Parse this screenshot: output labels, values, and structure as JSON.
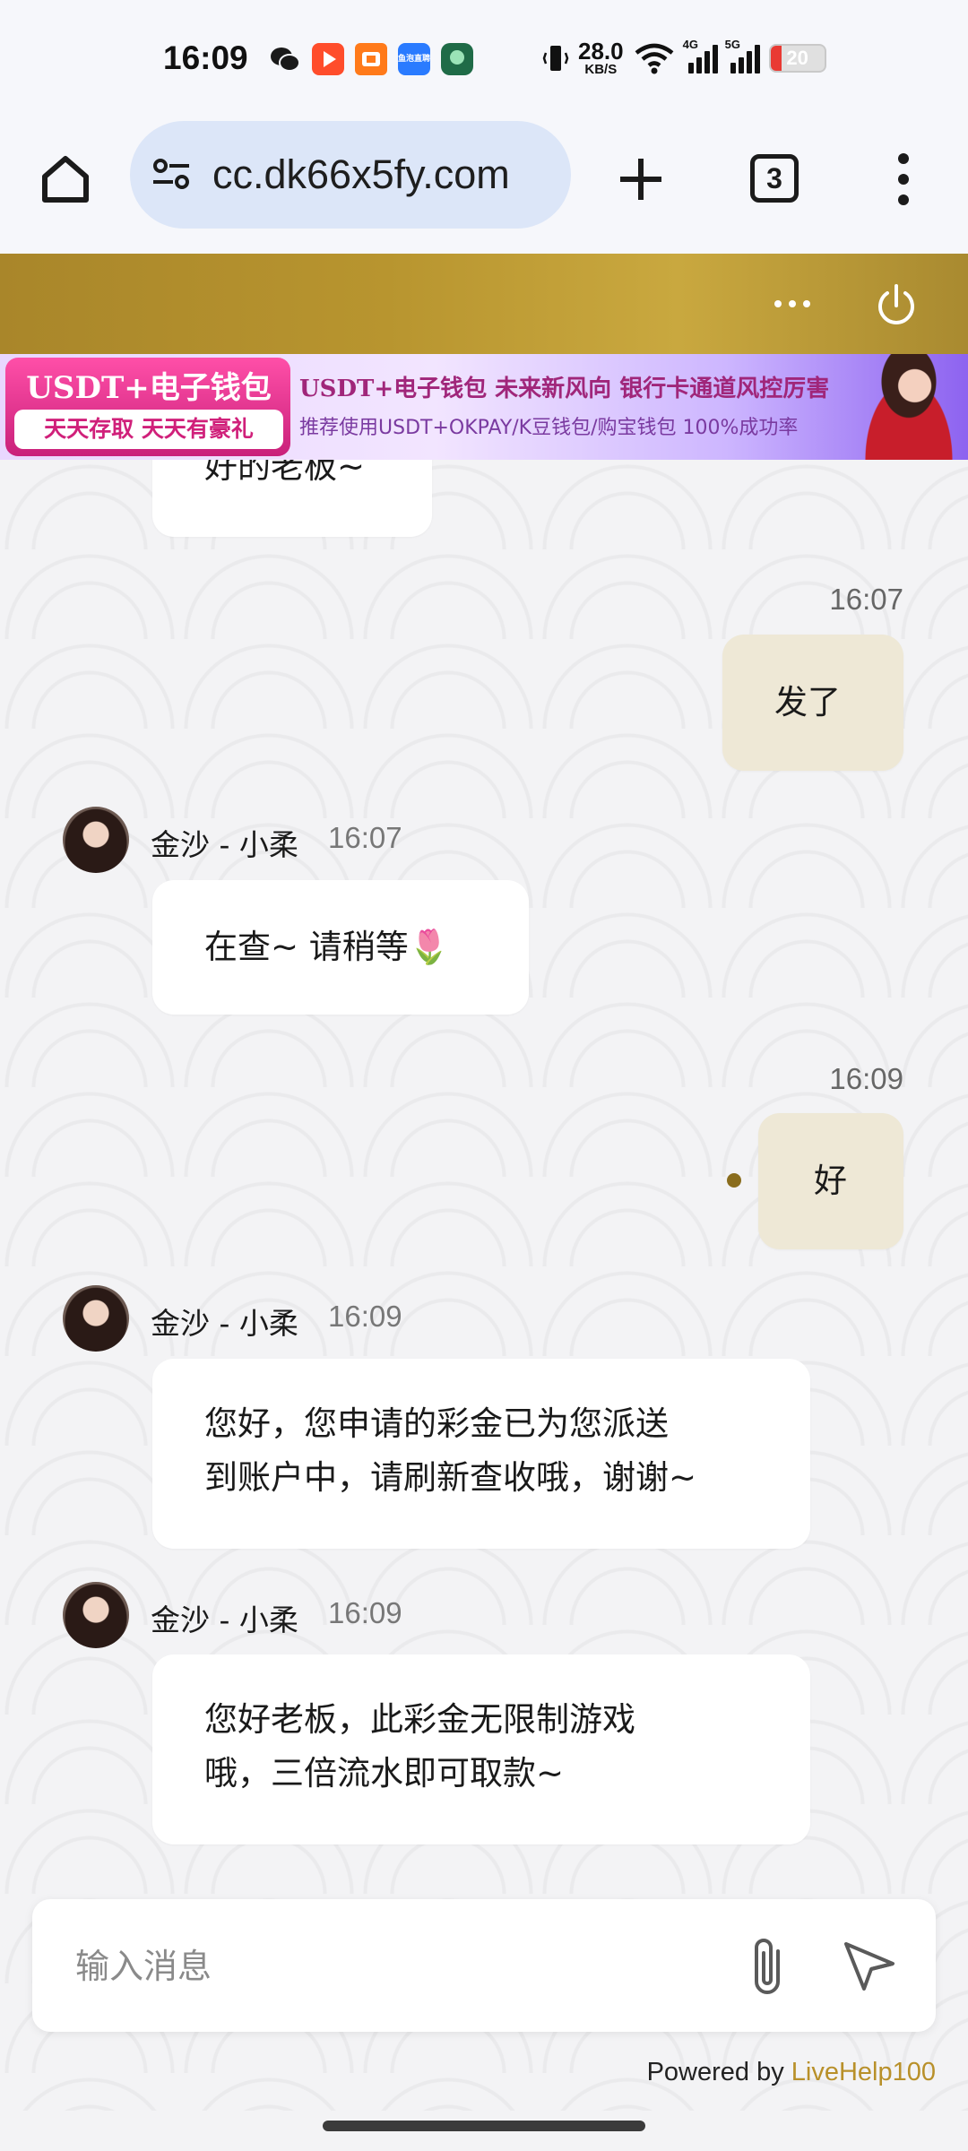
{
  "status_bar": {
    "time": "16:09",
    "app_icons": [
      "wechat-icon",
      "video-app-icon",
      "shop-app-icon",
      "live-app-icon",
      "green-app-icon"
    ],
    "live_app_text": "鱼泡直聘",
    "net_speed": "28.0",
    "net_speed_unit": "KB/S",
    "signal_labels": [
      "4G",
      "5G"
    ],
    "battery_level": "20",
    "battery_fraction": 0.2,
    "battery_color": "#e93a33"
  },
  "browser": {
    "url": "cc.dk66x5fy.com",
    "tab_count": "3"
  },
  "ad_banner": {
    "left_title": "USDT+电子钱包",
    "left_subtitle": "天天存取 天天有豪礼",
    "headline": "USDT+电子钱包   未来新风向   银行卡通道风控厉害",
    "subline": "推荐使用USDT+OKPAY/K豆钱包/购宝钱包   100%成功率"
  },
  "header": {
    "accent_color": "#b8952f"
  },
  "chat": {
    "messages": [
      {
        "direction": "in",
        "text": "好的老板~"
      },
      {
        "direction": "out",
        "time": "16:07",
        "text": "发了"
      },
      {
        "direction": "in",
        "sender": "金沙 - 小柔",
        "time": "16:07",
        "text": "在查~ 请稍等🌷"
      },
      {
        "direction": "out",
        "time": "16:09",
        "text": "好"
      },
      {
        "direction": "in",
        "sender": "金沙 - 小柔",
        "time": "16:09",
        "lines": [
          "您好，您申请的彩金已为您派送",
          "到账户中，请刷新查收哦，谢谢~"
        ]
      },
      {
        "direction": "in",
        "sender": "金沙 - 小柔",
        "time": "16:09",
        "lines": [
          "您好老板，此彩金无限制游戏",
          "哦，三倍流水即可取款~"
        ]
      }
    ]
  },
  "input": {
    "placeholder": "输入消息",
    "value": ""
  },
  "footer": {
    "powered_prefix": "Powered by ",
    "powered_brand": "LiveHelp100",
    "brand_color": "#b8902a"
  }
}
